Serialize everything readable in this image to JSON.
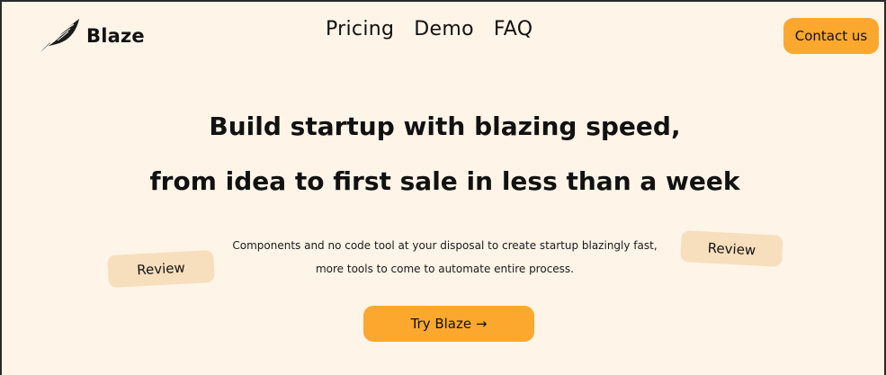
{
  "header": {
    "logo_icon": "feather-icon",
    "brand": "Blaze",
    "nav": [
      {
        "label": "Pricing"
      },
      {
        "label": "Demo"
      },
      {
        "label": "FAQ"
      }
    ],
    "contact_label": "Contact us"
  },
  "hero": {
    "headline_line1": "Build startup with blazing speed,",
    "headline_line2": "from idea to first sale in less than a week",
    "sub_line1": "Components and no code tool at your disposal to create startup blazingly fast,",
    "sub_line2": "more tools to come to automate entire process.",
    "cta_label": "Try Blaze →",
    "review_left": "Review",
    "review_right": "Review"
  },
  "colors": {
    "background": "#fef4e8",
    "accent": "#fca82e",
    "badge": "#f7dfbd",
    "text": "#111111"
  }
}
